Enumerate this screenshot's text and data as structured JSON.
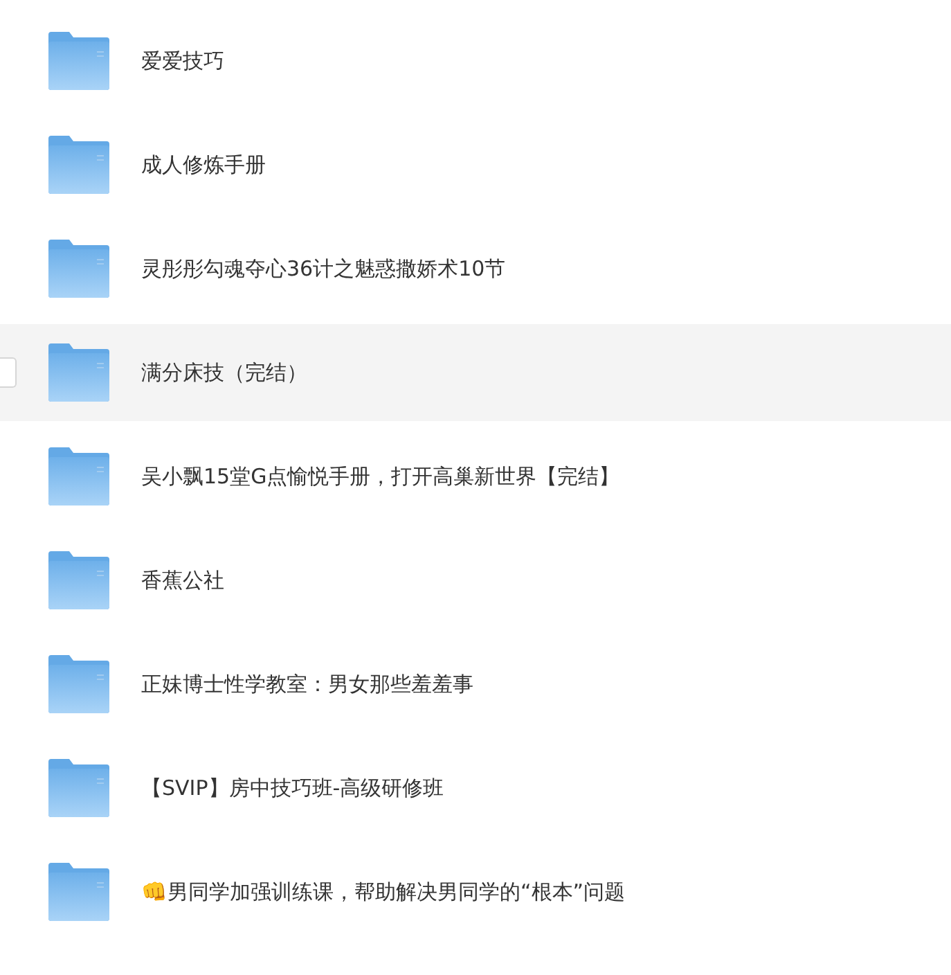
{
  "folders": [
    {
      "name": "爱爱技巧",
      "selected": false
    },
    {
      "name": "成人修炼手册",
      "selected": false
    },
    {
      "name": "灵彤彤勾魂夺心36计之魅惑撒娇术10节",
      "selected": false
    },
    {
      "name": "满分床技（完结）",
      "selected": true
    },
    {
      "name": "吴小飘15堂G点愉悦手册，打开高巢新世界【完结】",
      "selected": false
    },
    {
      "name": "香蕉公社",
      "selected": false
    },
    {
      "name": "正妹博士性学教室：男女那些羞羞事",
      "selected": false
    },
    {
      "name": "【SVIP】房中技巧班-高级研修班",
      "selected": false
    },
    {
      "name": "👊男同学加强训练课，帮助解决男同学的“根本”问题",
      "selected": false
    }
  ]
}
